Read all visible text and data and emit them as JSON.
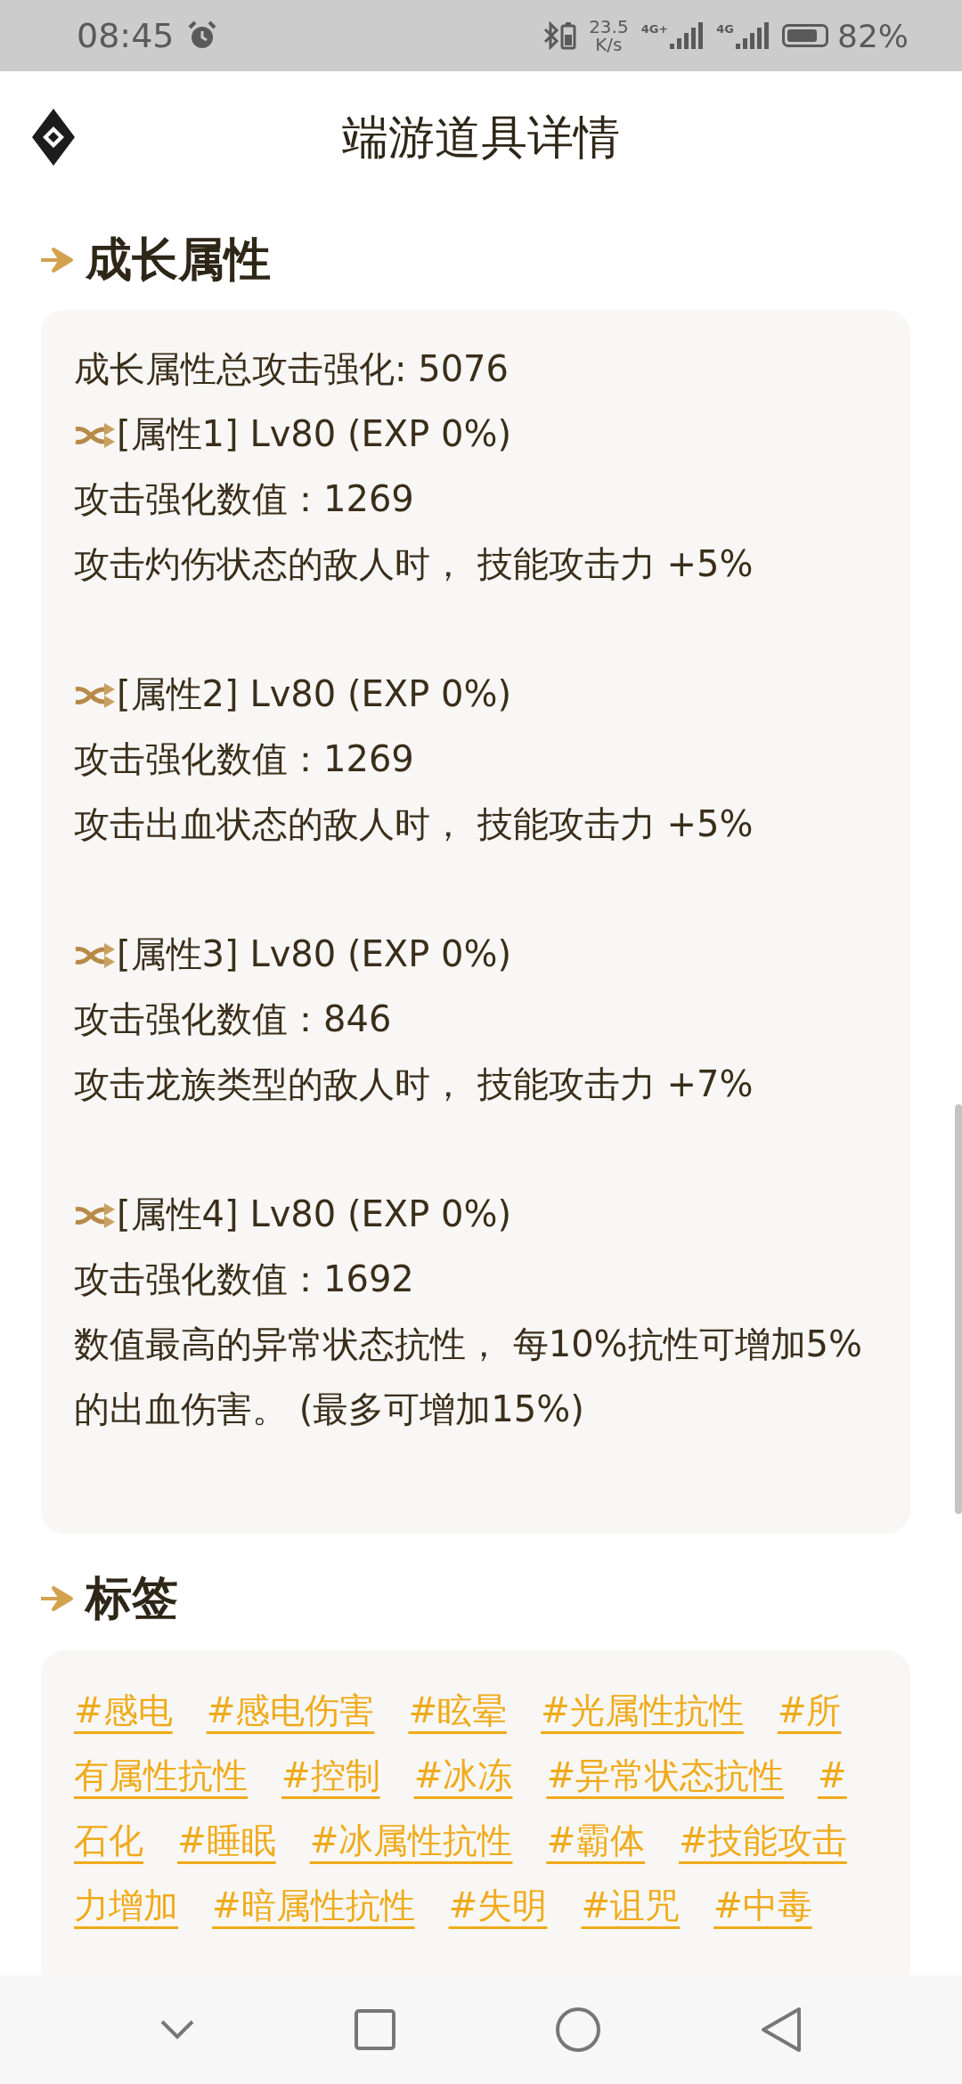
{
  "status_bar": {
    "time": "08:45",
    "net_speed": "23.5",
    "net_unit": "K/s",
    "sim_1": "4G+",
    "sim_2": "4G",
    "battery": "82%"
  },
  "header": {
    "title": "端游道具详情"
  },
  "growth": {
    "title": "成长属性",
    "total": "成长属性总攻击强化: 5076",
    "attributes": [
      {
        "header": "[属性1] Lv80 (EXP 0%)",
        "value": "攻击强化数值：1269",
        "effect": "攻击灼伤状态的敌人时， 技能攻击力 +5%"
      },
      {
        "header": "[属性2] Lv80 (EXP 0%)",
        "value": "攻击强化数值：1269",
        "effect": "攻击出血状态的敌人时， 技能攻击力 +5%"
      },
      {
        "header": "[属性3] Lv80 (EXP 0%)",
        "value": "攻击强化数值：846",
        "effect": "攻击龙族类型的敌人时， 技能攻击力 +7%"
      },
      {
        "header": "[属性4] Lv80 (EXP 0%)",
        "value": "攻击强化数值：1692",
        "effect": "数值最高的异常状态抗性， 每10%抗性可增加5%的出血伤害。 (最多可增加15%)"
      }
    ]
  },
  "tags": {
    "title": "标签",
    "rows": [
      [
        "#感电",
        "#感电伤害",
        "#眩晕",
        "#光属性抗性",
        "#所"
      ],
      [
        "有属性抗性",
        "#控制",
        "#冰冻",
        "#异常状态抗性",
        "#"
      ],
      [
        "石化",
        "#睡眠",
        "#冰属性抗性",
        "#霸体",
        "#技能攻击"
      ],
      [
        "力增加",
        "#暗属性抗性",
        "#失明",
        "#诅咒",
        "#中毒"
      ]
    ]
  }
}
